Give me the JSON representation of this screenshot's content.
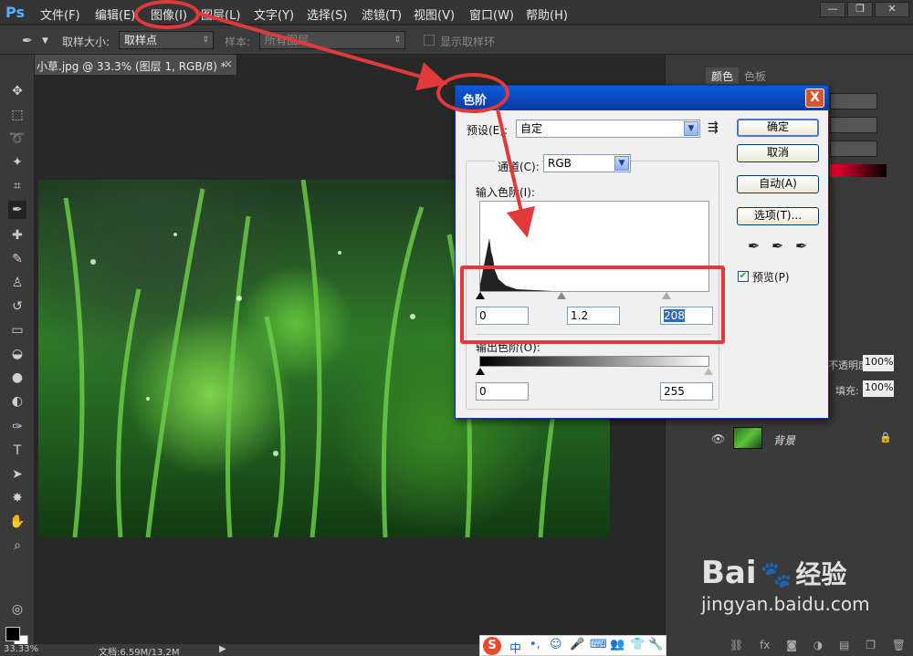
{
  "app": {
    "logo": "Ps"
  },
  "menu": [
    "文件(F)",
    "编辑(E)",
    "图像(I)",
    "图层(L)",
    "文字(Y)",
    "选择(S)",
    "滤镜(T)",
    "视图(V)",
    "窗口(W)",
    "帮助(H)"
  ],
  "window_controls": [
    "—",
    "❐",
    "✕"
  ],
  "options": {
    "sample_size_label": "取样大小:",
    "sample_size_value": "取样点",
    "sample_label": "样本:",
    "sample_value": "所有图层",
    "show_ring_label": "显示取样环"
  },
  "document": {
    "tab_title": "小草.jpg @ 33.3% (图层 1, RGB/8) *",
    "close": "×"
  },
  "status": {
    "zoom": "33.33%",
    "doc_info": "文档:6.59M/13.2M"
  },
  "right_panel": {
    "tabs": [
      "颜色",
      "色板"
    ],
    "opacity_label": "不透明度:",
    "opacity_value": "100%",
    "fill_label": "填充:",
    "fill_value": "100%",
    "background_layer_name": "背景"
  },
  "levels_dialog": {
    "title": "色阶",
    "close": "X",
    "preset_label": "预设(E):",
    "preset_value": "自定",
    "channel_label": "通道(C):",
    "channel_value": "RGB",
    "input_levels_label": "输入色阶(I):",
    "input_black": "0",
    "input_gamma": "1.2",
    "input_white": "208",
    "output_levels_label": "输出色阶(O):",
    "output_black": "0",
    "output_white": "255",
    "buttons": {
      "ok": "确定",
      "cancel": "取消",
      "auto": "自动(A)",
      "options": "选项(T)..."
    },
    "preview_label": "预览(P)",
    "preview_checked": true
  },
  "ime": {
    "label": "中"
  },
  "watermark": {
    "brand": "Bai",
    "brand2": "经验",
    "url": "jingyan.baidu.com"
  }
}
